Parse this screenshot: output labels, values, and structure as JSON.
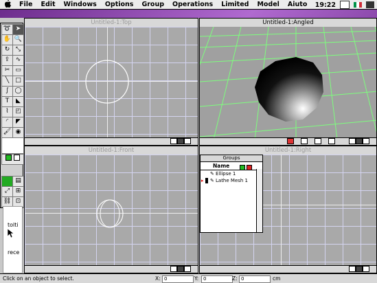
{
  "menubar": {
    "apple_icon": "apple-icon",
    "items": [
      "File",
      "Edit",
      "Windows",
      "Options",
      "Group",
      "Operations",
      "Limited",
      "Model",
      "Aiuto"
    ],
    "clock": "19:22"
  },
  "viewports": {
    "top": {
      "title": "Untitled-1:Top"
    },
    "angled": {
      "title": "Untitled-1:Angled"
    },
    "front": {
      "title": "Untitled-1:Front"
    },
    "right": {
      "title": "Untitled-1:Right"
    }
  },
  "groups_panel": {
    "title": "Groups",
    "header_name": "Name",
    "items": [
      "Ellipse 1",
      "Lathe Mesh 1"
    ]
  },
  "sidebar_text": {
    "line1": "tolti",
    "line2": "rece"
  },
  "status": {
    "message": "Click on an object to select.",
    "x_label": "X:",
    "x_value": "0",
    "y_label": "Y:",
    "y_value": "0",
    "z_label": "Z:",
    "z_value": "0",
    "unit": "cm"
  },
  "colors": {
    "grid_line": "#d4d4f0",
    "angled_grid": "#7dff7d",
    "desktop": "#8a4aa0"
  }
}
